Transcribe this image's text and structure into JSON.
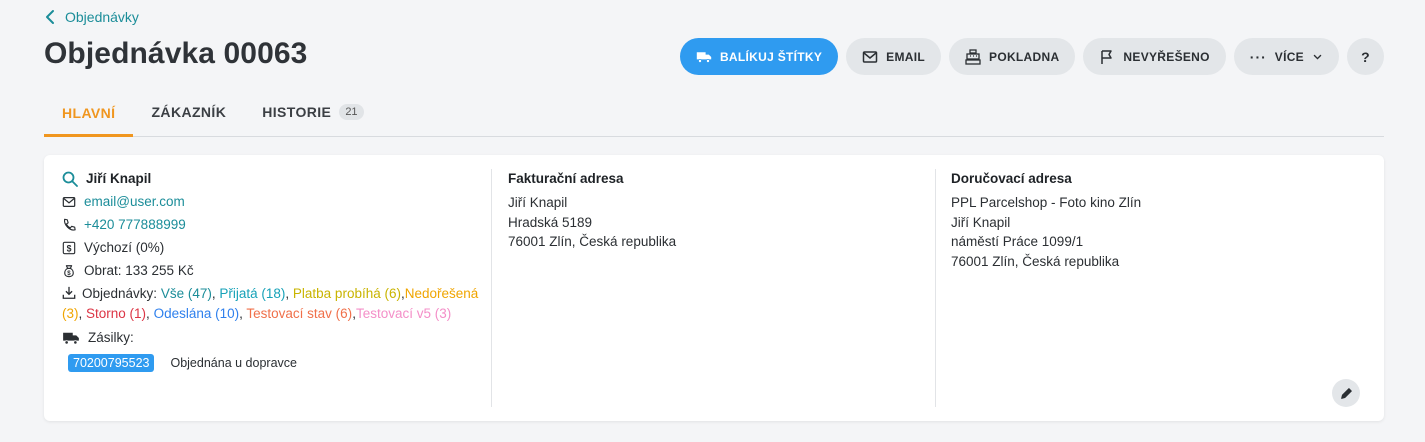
{
  "breadcrumb": {
    "back_label": "Objednávky"
  },
  "page": {
    "title": "Objednávka 00063"
  },
  "actions": {
    "balikuj": "BALÍKUJ ŠTÍTKY",
    "email": "EMAIL",
    "pokladna": "POKLADNA",
    "nevyreseno": "NEVYŘEŠENO",
    "vice": "VÍCE",
    "help": "?"
  },
  "tabs": [
    {
      "label": "HLAVNÍ",
      "active": true
    },
    {
      "label": "ZÁKAZNÍK"
    },
    {
      "label": "HISTORIE",
      "count": "21"
    }
  ],
  "customer": {
    "name": "Jiří Knapil",
    "email": "email@user.com",
    "phone": "+420 777888999",
    "pricelist": "Výchozí (0%)",
    "turnover": "Obrat: 133 255 Kč",
    "orders_label": "Objednávky:",
    "orders": [
      {
        "text": "Vše (47)",
        "sep": ", ",
        "color": "#1b8d99"
      },
      {
        "text": "Přijatá (18)",
        "sep": ", ",
        "color": "#17a2b8"
      },
      {
        "text": "Platba probíhá (6)",
        "sep": ",",
        "color": "#c9b400"
      },
      {
        "text": "Nedořešená (3)",
        "sep": ", ",
        "color": "#f0a500"
      },
      {
        "text": "Storno (1)",
        "sep": ", ",
        "color": "#dc3545"
      },
      {
        "text": "Odeslána (10)",
        "sep": ", ",
        "color": "#2f80ed"
      },
      {
        "text": "Testovací stav (6)",
        "sep": ",",
        "color": "#f0704a"
      },
      {
        "text": "Testovací v5 (3)",
        "sep": "",
        "color": "#f48fc8"
      }
    ],
    "shipments_label": "Zásilky:",
    "shipment_number": "70200795523",
    "shipment_status": "Objednána u dopravce"
  },
  "billing": {
    "heading": "Fakturační adresa",
    "lines": [
      "Jiří Knapil",
      "Hradská 5189",
      "76001 Zlín, Česká republika"
    ]
  },
  "delivery": {
    "heading": "Doručovací adresa",
    "lines": [
      "PPL Parcelshop - Foto kino Zlín",
      "Jiří Knapil",
      "náměstí Práce 1099/1",
      "76001 Zlín, Česká republika"
    ]
  },
  "colors": {
    "accent": "#1b8d99",
    "primary": "#2f9bf0",
    "tab_active": "#f0961f"
  }
}
